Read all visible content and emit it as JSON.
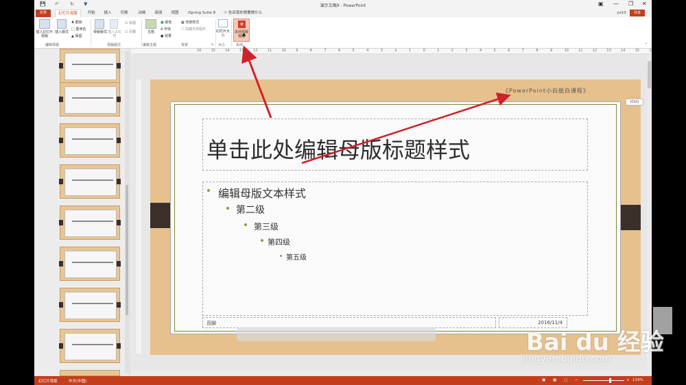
{
  "window": {
    "title": "演示文稿9 - PowerPoint",
    "user": "yx10",
    "share_label": "共享",
    "search_hint": "告诉我你想要做什么"
  },
  "tabs": [
    "文件",
    "幻灯片母版",
    "开始",
    "插入",
    "切换",
    "动画",
    "审阅",
    "视图",
    "iSpring Suite 8"
  ],
  "ribbon": {
    "insert_master": "插入幻灯片母版",
    "insert_layout": "插入版式",
    "delete": "删除",
    "rename": "重命名",
    "preserve": "保留",
    "master_layout": "母版版式",
    "insert_placeholder": "插入占位符",
    "title": "标题",
    "footer": "页脚",
    "themes": "主题",
    "colors": "颜色",
    "fonts": "字体",
    "effects": "效果",
    "background_styles": "背景样式",
    "hide_bg": "隐藏背景图形",
    "slide_size": "幻灯片大小",
    "close_master": "关闭母版视图",
    "groups": {
      "edit_master": "编辑母版",
      "master_layout": "母版版式",
      "edit_theme": "编辑主题",
      "background": "背景",
      "size": "大小",
      "close": "关闭"
    }
  },
  "ruler_labels": [
    "16",
    "15",
    "14",
    "13",
    "12",
    "11",
    "10",
    "9",
    "8",
    "7",
    "6",
    "5",
    "4",
    "3",
    "2",
    "1",
    "0",
    "1",
    "2",
    "3",
    "4",
    "5",
    "6",
    "7",
    "8",
    "9",
    "10",
    "11",
    "12",
    "13",
    "14",
    "15",
    "16"
  ],
  "slide": {
    "watermark_text": "《PowerPoint小白脱白课程》",
    "title_text": "单击此处编辑母版标题样式",
    "levels": [
      "编辑母版文本样式",
      "第二级",
      "第三级",
      "第四级",
      "第五级"
    ],
    "footer": "页脚",
    "date": "2016/11/4",
    "ctrl_badge": "(Ctrl)"
  },
  "status": {
    "view": "幻灯片母版",
    "language": "中文(中国)",
    "zoom": "119%"
  },
  "watermark": {
    "brand": "Bai du 经验",
    "url": "jingyan.baidu.com"
  },
  "colors": {
    "accent": "#c43e1c",
    "slide_bg": "#e6c08d",
    "arrow": "#d0202a"
  }
}
